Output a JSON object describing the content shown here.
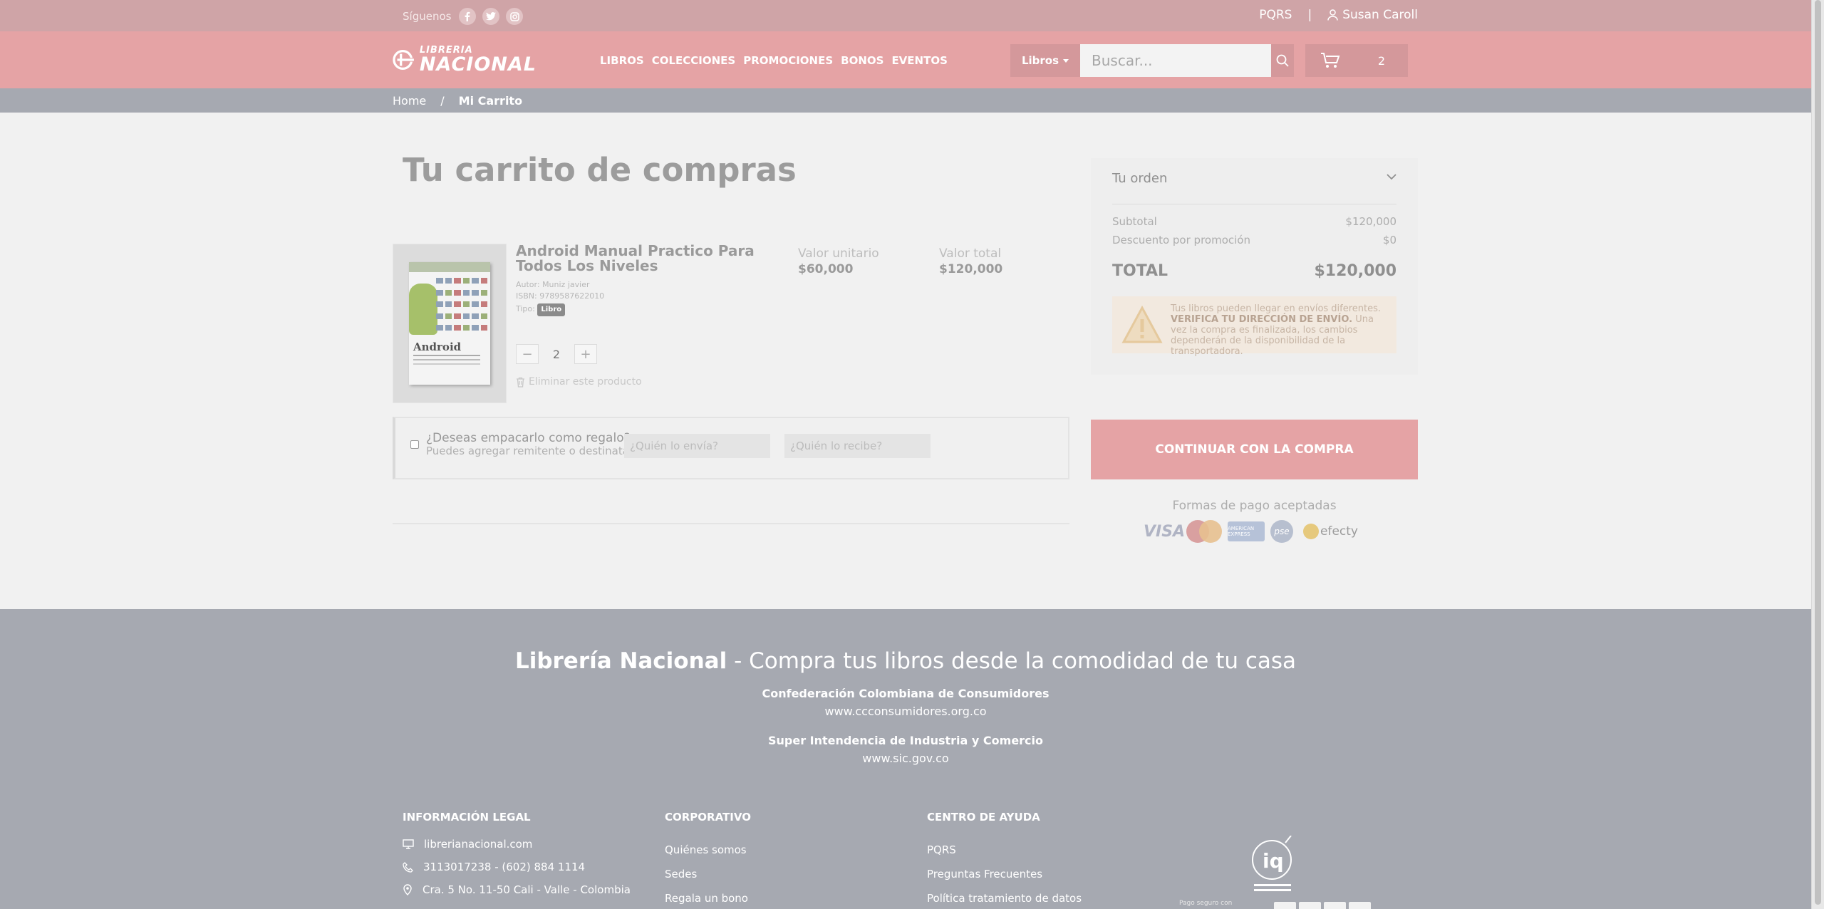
{
  "topbar": {
    "follow_label": "Síguenos",
    "social_icons": [
      "facebook-icon",
      "twitter-icon",
      "instagram-icon"
    ],
    "pqrs": "PQRS",
    "divider": "|",
    "user_name": "Susan Caroll"
  },
  "header": {
    "logo_line1": "LIBRERIA",
    "logo_line2": "NACIONAL",
    "nav": [
      "LIBROS",
      "COLECCIONES",
      "PROMOCIONES",
      "BONOS",
      "EVENTOS"
    ],
    "search_category": "Libros",
    "search_placeholder": "Buscar...",
    "cart_count": "2"
  },
  "breadcrumb": {
    "home": "Home",
    "separator": "/",
    "current": "Mi Carrito"
  },
  "cart": {
    "title": "Tu carrito de compras",
    "item": {
      "name": "Android Manual Practico Para Todos Los Niveles",
      "author": "Autor: Muniz javier",
      "isbn": "ISBN: 9789587622010",
      "type_label": "Tipo:",
      "type_value": "Libro",
      "cover_title": "Android",
      "quantity": "2",
      "minus": "−",
      "plus": "+",
      "remove_label": "Eliminar este producto",
      "unit_label": "Valor unitario",
      "unit_price": "$60,000",
      "total_label": "Valor total",
      "total_price": "$120,000"
    },
    "gift": {
      "question": "¿Deseas empacarlo como regalo?",
      "subtitle": "Puedes agregar remitente o destinatario",
      "sender_placeholder": "¿Quién lo envía?",
      "receiver_placeholder": "¿Quién lo recibe?"
    }
  },
  "order": {
    "title": "Tu orden",
    "subtotal_label": "Subtotal",
    "subtotal_value": "$120,000",
    "discount_label": "Descuento por promoción",
    "discount_value": "$0",
    "total_label": "TOTAL",
    "total_value": "$120,000",
    "notice_intro": "Tus libros pueden llegar en envíos diferentes.",
    "notice_bold": "VERIFICA TU DIRECCIÓN DE ENVÍO.",
    "notice_rest": "Una vez la compra es finalizada, los cambios dependerán de la disponibilidad de la transportadora.",
    "continue_label": "CONTINUAR CON LA COMPRA",
    "payment_title": "Formas de pago aceptadas",
    "payment_methods": {
      "visa": "VISA",
      "mastercard": "MasterCard",
      "amex": "AMERICAN EXPRESS",
      "pse": "pse",
      "efecty": "efecty"
    }
  },
  "footer": {
    "brand": "Librería Nacional",
    "tagline": " - Compra tus libros desde la comodidad de tu casa",
    "org1_name": "Confederación Colombiana de Consumidores",
    "org1_url": "www.ccconsumidores.org.co",
    "org2_name": "Super Intendencia de Industria y Comercio",
    "org2_url": "www.sic.gov.co",
    "legal": {
      "heading": "INFORMACIÓN LEGAL",
      "website": "librerianacional.com",
      "phone": "3113017238 - (602) 884 1114",
      "address": "Cra. 5 No. 11-50 Cali - Valle - Colombia"
    },
    "corporate": {
      "heading": "CORPORATIVO",
      "items": [
        "Quiénes somos",
        "Sedes",
        "Regala un bono"
      ]
    },
    "help": {
      "heading": "CENTRO DE AYUDA",
      "items": [
        "PQRS",
        "Preguntas Frecuentes",
        "Política tratamiento de datos"
      ]
    },
    "secure_label": "Pago seguro con"
  }
}
